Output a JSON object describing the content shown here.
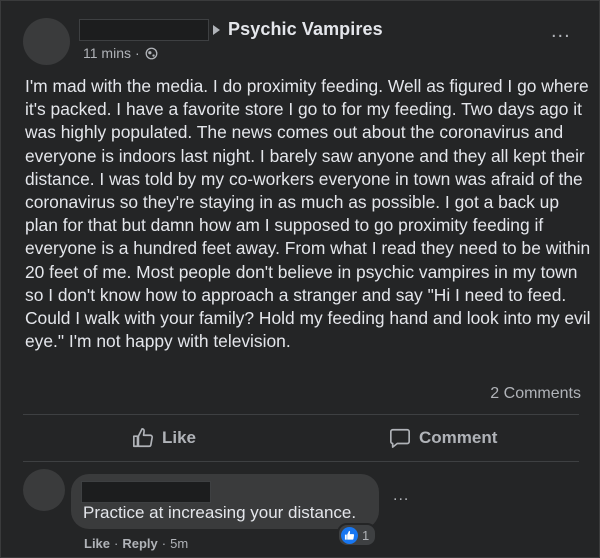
{
  "post": {
    "group_name": "Psychic Vampires",
    "time": "11 mins",
    "separator": "·",
    "audience_icon": "globe-icon",
    "more_icon": "...",
    "text": "I'm mad with the media. I do proximity feeding. Well as figured I go where it's packed. I have a favorite store I go to for my feeding. Two days ago it was highly populated. The news comes out about the coronavirus and everyone is indoors last night. I barely saw anyone and they all kept their distance. I was told by my co-workers everyone in town was afraid of the coronavirus so they're staying in as much as possible. I got a back up plan for that but damn how am I supposed to go proximity feeding if everyone is a hundred feet away. From what I read they need to be within 20 feet of me. Most people don't believe in psychic vampires in my town so I don't know how to approach a stranger and say \"Hi I need to feed. Could I walk with your family? Hold my feeding hand and look into my evil eye.\" I'm not happy with television.",
    "comments_count": "2 Comments"
  },
  "actions": {
    "like_label": "Like",
    "comment_label": "Comment"
  },
  "comment": {
    "text": "Practice at increasing your distance.",
    "more_icon": "...",
    "reaction_count": "1",
    "like_label": "Like",
    "reply_label": "Reply",
    "meta_separator": "·",
    "time": "5m"
  },
  "colors": {
    "background": "#242526",
    "text": "#e4e6eb",
    "secondary_text": "#b0b3b8",
    "like_blue": "#1877f2"
  }
}
